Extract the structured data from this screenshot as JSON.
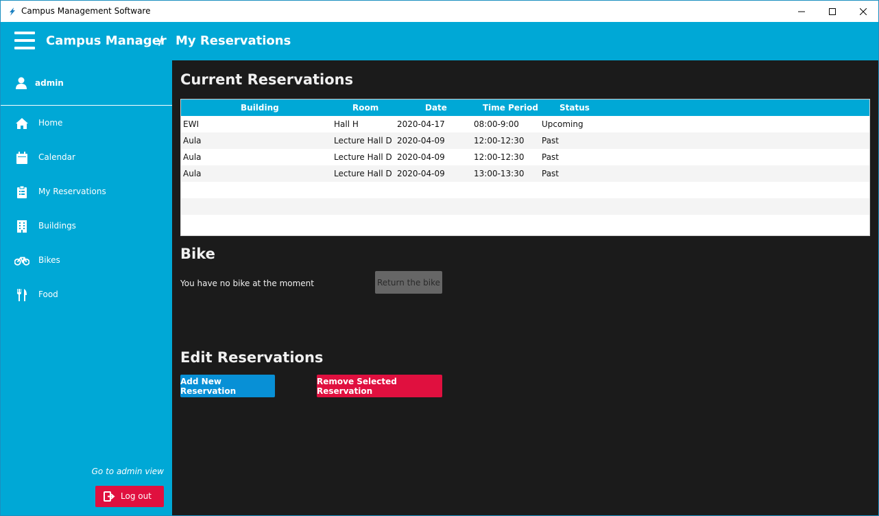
{
  "window": {
    "title": "Campus Management Software"
  },
  "header": {
    "app_name": "Campus Manager",
    "separator": "/",
    "page": "My Reservations"
  },
  "sidebar": {
    "user": "admin",
    "items": [
      {
        "label": "Home",
        "icon": "home-icon"
      },
      {
        "label": "Calendar",
        "icon": "calendar-icon"
      },
      {
        "label": "My Reservations",
        "icon": "clipboard-icon"
      },
      {
        "label": "Buildings",
        "icon": "building-icon"
      },
      {
        "label": "Bikes",
        "icon": "bike-icon"
      },
      {
        "label": "Food",
        "icon": "fork-knife-icon"
      }
    ],
    "admin_link": "Go to admin view",
    "logout_label": "Log out"
  },
  "reservations": {
    "title": "Current Reservations",
    "columns": [
      "Building",
      "Room",
      "Date",
      "Time Period",
      "Status"
    ],
    "rows": [
      [
        "EWI",
        "Hall H",
        "2020-04-17",
        "08:00-9:00",
        "Upcoming"
      ],
      [
        "Aula",
        "Lecture Hall D",
        "2020-04-09",
        "12:00-12:30",
        "Past"
      ],
      [
        "Aula",
        "Lecture Hall D",
        "2020-04-09",
        "12:00-12:30",
        "Past"
      ],
      [
        "Aula",
        "Lecture Hall D",
        "2020-04-09",
        "13:00-13:30",
        "Past"
      ]
    ]
  },
  "bike": {
    "title": "Bike",
    "status_text": "You have no bike at the moment",
    "return_label": "Return the bike"
  },
  "edit": {
    "title": "Edit Reservations",
    "add_label": "Add New Reservation",
    "remove_label": "Remove Selected Reservation"
  },
  "colors": {
    "accent": "#00a8d6",
    "danger": "#e0103f",
    "main_bg": "#1b1b1b"
  }
}
